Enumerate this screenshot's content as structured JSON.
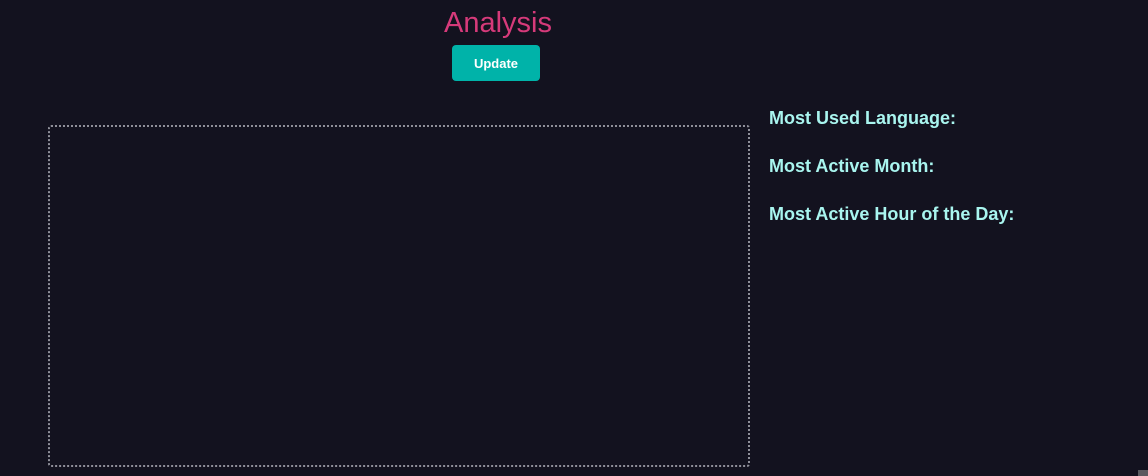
{
  "header": {
    "title": "Analysis",
    "update_label": "Update"
  },
  "chart_area": {
    "content": ""
  },
  "stats": [
    {
      "label": "Most Used Language:",
      "value": ""
    },
    {
      "label": "Most Active Month:",
      "value": ""
    },
    {
      "label": "Most Active Hour of the Day:",
      "value": ""
    }
  ],
  "colors": {
    "background": "#13121f",
    "title": "#d63a7a",
    "button": "#00b3a9",
    "stat_text": "#a9f5ef",
    "chart_border": "#8f8f99"
  }
}
